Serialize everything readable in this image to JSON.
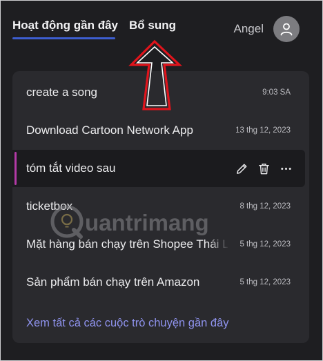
{
  "tabs": {
    "recent_label": "Hoạt động gần đây",
    "extra_label": "Bổ sung"
  },
  "user": {
    "name": "Angel"
  },
  "conversations": [
    {
      "title": "create a song",
      "date": "9:03 SA"
    },
    {
      "title": "Download Cartoon Network App",
      "date": "13 thg 12, 2023"
    },
    {
      "title": "tóm tắt video sau",
      "date": ""
    },
    {
      "title": "ticketbox",
      "date": "8 thg 12, 2023"
    },
    {
      "title": "Mặt hàng bán chạy trên Shopee Thái L",
      "date": "5 thg 12, 2023"
    },
    {
      "title": "Sản phẩm bán chạy trên Amazon",
      "date": "5 thg 12, 2023"
    }
  ],
  "see_all_label": "Xem tất cả các cuộc trò chuyện gần đây",
  "watermark": "uantrimang",
  "icons": {
    "avatar": "user-icon",
    "edit": "pencil-icon",
    "delete": "trash-icon",
    "more": "more-horizontal-icon"
  },
  "colors": {
    "tab_underline": "#3d5ed0",
    "active_accent": "#b33aa6",
    "link": "#8f93ee",
    "annotation_arrow": "#e0141c"
  }
}
